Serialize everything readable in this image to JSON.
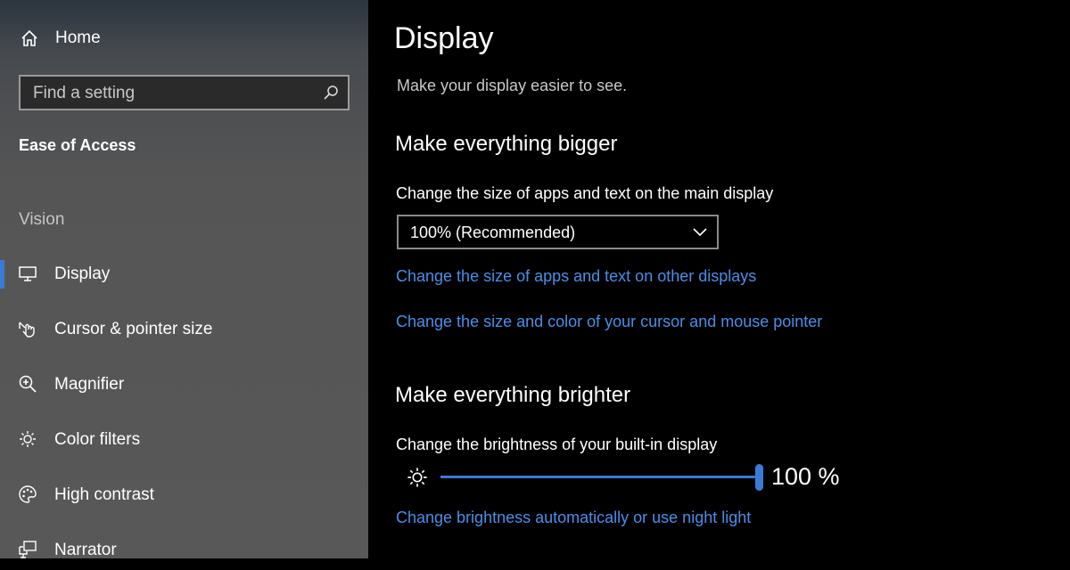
{
  "sidebar": {
    "home": "Home",
    "search_placeholder": "Find a setting",
    "section_title": "Ease of Access",
    "group": "Vision",
    "items": [
      {
        "label": "Display",
        "icon": "monitor-icon",
        "selected": true
      },
      {
        "label": "Cursor & pointer size",
        "icon": "cursor-hand-icon"
      },
      {
        "label": "Magnifier",
        "icon": "magnifier-icon"
      },
      {
        "label": "Color filters",
        "icon": "sun-icon"
      },
      {
        "label": "High contrast",
        "icon": "palette-icon"
      },
      {
        "label": "Narrator",
        "icon": "narrator-icon"
      }
    ],
    "accent": "#3a7bd5"
  },
  "main": {
    "title": "Display",
    "subtitle": "Make your display easier to see.",
    "bigger": {
      "heading": "Make everything bigger",
      "label": "Change the size of apps and text on the main display",
      "dropdown_value": "100% (Recommended)",
      "link1": "Change the size of apps and text on other displays",
      "link2": "Change the size and color of your cursor and mouse pointer"
    },
    "brighter": {
      "heading": "Make everything brighter",
      "label": "Change the brightness of your built-in display",
      "brightness_value": 100,
      "brightness_text": "100 %",
      "link": "Change brightness automatically or use night light"
    },
    "link_color": "#4a8ee8"
  }
}
